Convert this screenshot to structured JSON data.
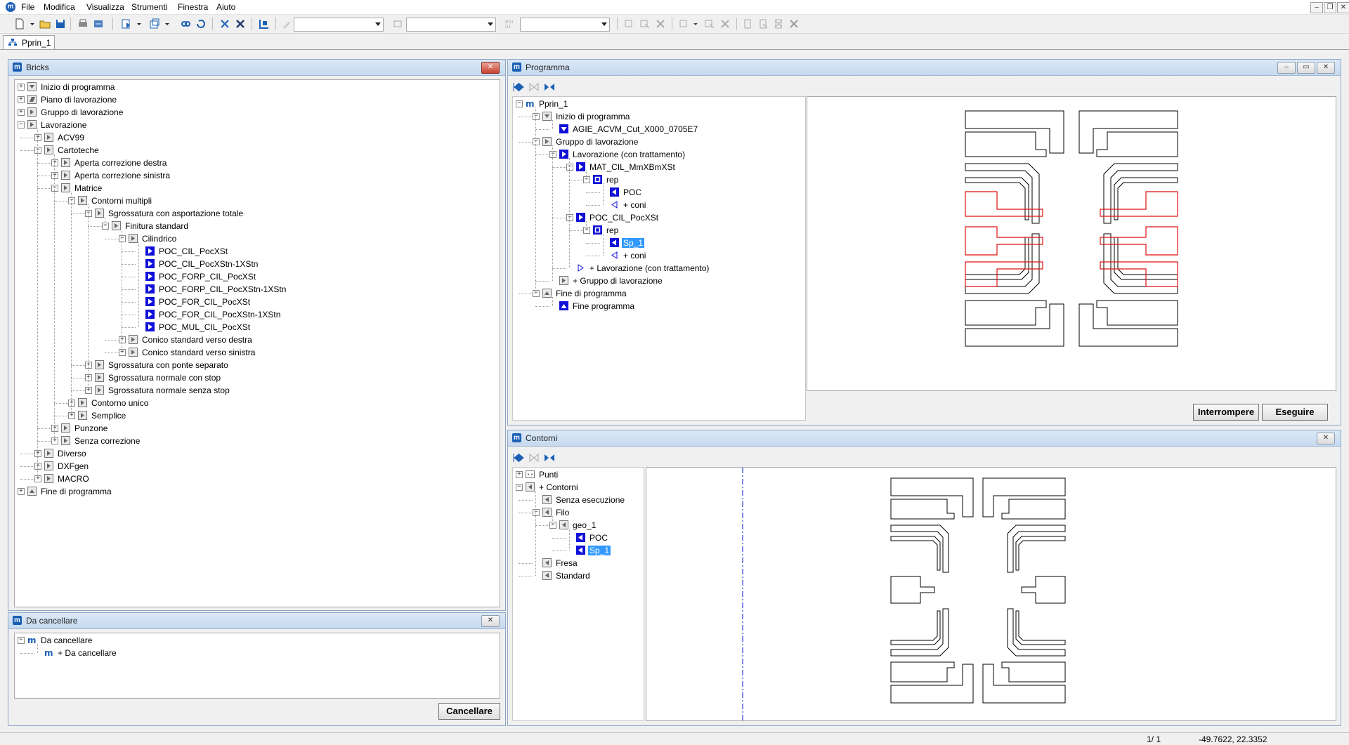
{
  "menu": {
    "items": [
      "File",
      "Modifica",
      "Visualizza",
      "Strumenti",
      "Finestra",
      "Aiuto"
    ]
  },
  "doc_tab": "Pprin_1",
  "bricks": {
    "title": "Bricks",
    "tree": [
      {
        "d": 0,
        "t": "Inizio di programma",
        "e": "+",
        "i": "down"
      },
      {
        "d": 0,
        "t": "Piano di lavorazione",
        "e": "+",
        "i": "plane"
      },
      {
        "d": 0,
        "t": "Gruppo di lavorazione",
        "e": "+",
        "i": "right"
      },
      {
        "d": 0,
        "t": "Lavorazione",
        "e": "-",
        "i": "right"
      },
      {
        "d": 1,
        "t": "ACV99",
        "e": "+",
        "i": "right"
      },
      {
        "d": 1,
        "t": "Cartoteche",
        "e": "-",
        "i": "right"
      },
      {
        "d": 2,
        "t": "Aperta correzione destra",
        "e": "+",
        "i": "right"
      },
      {
        "d": 2,
        "t": "Aperta correzione sinistra",
        "e": "+",
        "i": "right"
      },
      {
        "d": 2,
        "t": "Matrice",
        "e": "-",
        "i": "right"
      },
      {
        "d": 3,
        "t": "Contorni multipli",
        "e": "-",
        "i": "right"
      },
      {
        "d": 4,
        "t": "Sgrossatura con asportazione totale",
        "e": "-",
        "i": "right"
      },
      {
        "d": 5,
        "t": "Finitura standard",
        "e": "-",
        "i": "right"
      },
      {
        "d": 6,
        "t": "Cilindrico",
        "e": "-",
        "i": "right"
      },
      {
        "d": 7,
        "t": "POC_CIL_PocXSt",
        "e": "",
        "i": "blue"
      },
      {
        "d": 7,
        "t": "POC_CIL_PocXStn-1XStn",
        "e": "",
        "i": "blue"
      },
      {
        "d": 7,
        "t": "POC_FORP_CIL_PocXSt",
        "e": "",
        "i": "blue"
      },
      {
        "d": 7,
        "t": "POC_FORP_CIL_PocXStn-1XStn",
        "e": "",
        "i": "blue"
      },
      {
        "d": 7,
        "t": "POC_FOR_CIL_PocXSt",
        "e": "",
        "i": "blue"
      },
      {
        "d": 7,
        "t": "POC_FOR_CIL_PocXStn-1XStn",
        "e": "",
        "i": "blue"
      },
      {
        "d": 7,
        "t": "POC_MUL_CIL_PocXSt",
        "e": "",
        "i": "blue"
      },
      {
        "d": 6,
        "t": "Conico standard verso destra",
        "e": "+",
        "i": "right"
      },
      {
        "d": 6,
        "t": "Conico standard verso sinistra",
        "e": "+",
        "i": "right"
      },
      {
        "d": 4,
        "t": "Sgrossatura con ponte separato",
        "e": "+",
        "i": "right"
      },
      {
        "d": 4,
        "t": "Sgrossatura normale con stop",
        "e": "+",
        "i": "right"
      },
      {
        "d": 4,
        "t": "Sgrossatura normale senza stop",
        "e": "+",
        "i": "right"
      },
      {
        "d": 3,
        "t": "Contorno unico",
        "e": "+",
        "i": "right"
      },
      {
        "d": 3,
        "t": "Semplice",
        "e": "+",
        "i": "right"
      },
      {
        "d": 2,
        "t": "Punzone",
        "e": "+",
        "i": "right"
      },
      {
        "d": 2,
        "t": "Senza correzione",
        "e": "+",
        "i": "right"
      },
      {
        "d": 1,
        "t": "Diverso",
        "e": "+",
        "i": "right"
      },
      {
        "d": 1,
        "t": "DXFgen",
        "e": "+",
        "i": "right"
      },
      {
        "d": 1,
        "t": "MACRO",
        "e": "+",
        "i": "right"
      },
      {
        "d": 0,
        "t": "Fine di programma",
        "e": "+",
        "i": "up"
      }
    ]
  },
  "delete_panel": {
    "title": "Da cancellare",
    "tree": [
      {
        "d": 0,
        "t": "Da cancellare",
        "e": "-",
        "i": "m"
      },
      {
        "d": 1,
        "t": "+ Da cancellare",
        "e": "",
        "i": "m"
      }
    ],
    "button": "Cancellare"
  },
  "program": {
    "title": "Programma",
    "tree": [
      {
        "d": 0,
        "t": "Pprin_1",
        "e": "-",
        "i": "m"
      },
      {
        "d": 1,
        "t": "Inizio di programma",
        "e": "-",
        "i": "down"
      },
      {
        "d": 2,
        "t": "AGIE_ACVM_Cut_X000_0705E7",
        "e": "",
        "i": "bluedown"
      },
      {
        "d": 1,
        "t": "Gruppo di lavorazione",
        "e": "-",
        "i": "right"
      },
      {
        "d": 2,
        "t": "Lavorazione (con trattamento)",
        "e": "-",
        "i": "blueright"
      },
      {
        "d": 3,
        "t": "MAT_CIL_MmXBmXSt",
        "e": "-",
        "i": "blue"
      },
      {
        "d": 4,
        "t": "rep",
        "e": "-",
        "i": "rep"
      },
      {
        "d": 5,
        "t": "POC",
        "e": "",
        "i": "blueleft"
      },
      {
        "d": 5,
        "t": "+ coni",
        "e": "",
        "i": "outleft"
      },
      {
        "d": 3,
        "t": "POC_CIL_PocXSt",
        "e": "-",
        "i": "blue"
      },
      {
        "d": 4,
        "t": "rep",
        "e": "-",
        "i": "rep"
      },
      {
        "d": 5,
        "t": "Sp_1",
        "e": "",
        "i": "blueleft",
        "sel": true
      },
      {
        "d": 5,
        "t": "+ coni",
        "e": "",
        "i": "outleft"
      },
      {
        "d": 3,
        "t": "+ Lavorazione (con trattamento)",
        "e": "",
        "i": "outright"
      },
      {
        "d": 2,
        "t": "+ Gruppo di lavorazione",
        "e": "",
        "i": "right"
      },
      {
        "d": 1,
        "t": "Fine di programma",
        "e": "-",
        "i": "up"
      },
      {
        "d": 2,
        "t": "Fine programma",
        "e": "",
        "i": "blueup"
      }
    ],
    "btn_stop": "Interrompere",
    "btn_run": "Eseguire"
  },
  "contours": {
    "title": "Contorni",
    "tree": [
      {
        "d": 0,
        "t": "Punti",
        "e": "+",
        "i": "pts"
      },
      {
        "d": 0,
        "t": "+ Contorni",
        "e": "-",
        "i": "left"
      },
      {
        "d": 1,
        "t": "Senza esecuzione",
        "e": "",
        "i": "left"
      },
      {
        "d": 1,
        "t": "Filo",
        "e": "-",
        "i": "left"
      },
      {
        "d": 2,
        "t": "geo_1",
        "e": "-",
        "i": "left"
      },
      {
        "d": 3,
        "t": "POC",
        "e": "",
        "i": "blueleft"
      },
      {
        "d": 3,
        "t": "Sp_1",
        "e": "",
        "i": "blueleft",
        "sel": true
      },
      {
        "d": 1,
        "t": "Fresa",
        "e": "",
        "i": "left"
      },
      {
        "d": 1,
        "t": "Standard",
        "e": "",
        "i": "left"
      }
    ]
  },
  "status": {
    "page": "1/ 1",
    "coords": "-49.7622,  22.3352"
  },
  "colors": {
    "accent": "#1a5fb4",
    "selection": "#3399ff",
    "highlight_contour": "#e01010"
  },
  "icons": [
    "new-icon",
    "open-icon",
    "save-icon",
    "print-icon",
    "export-icon"
  ]
}
